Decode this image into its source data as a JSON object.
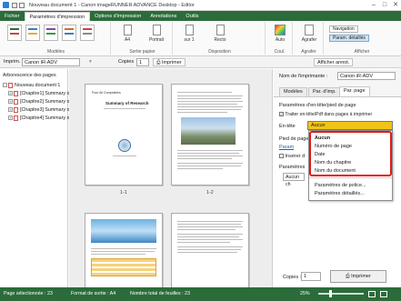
{
  "window": {
    "title": "Nouveau document 1 - Canon imageRUNNER ADVANCE Desktop - Editor",
    "controls": [
      "–",
      "□",
      "✕"
    ]
  },
  "ribbon_tabs": [
    "Fichier",
    "Paramètres d'impression",
    "Options d'impression",
    "Annotations",
    "Outils"
  ],
  "ribbon": {
    "groups": {
      "models": "Modèles",
      "sortie": "Sortie papier",
      "disposition": "Disposition",
      "couleur": "Coul.",
      "agrafer": "Agrafer",
      "afficher": "Afficher"
    },
    "buttons": {
      "a4": "A4",
      "portrait": "Portrait",
      "sur1": "sur 1",
      "recto": "Recto",
      "auto": "Auto",
      "agrafer": "Agrafer",
      "navigation": "Navigation",
      "param_details": "Param. détaillés"
    }
  },
  "toolbar": {
    "imprim_label": "Imprim.",
    "printer": "Canon iR-ADV",
    "copies_label": "Copies",
    "copies_value": "1",
    "print_button": "Imprimer",
    "show_annot": "Afficher annot."
  },
  "tree": {
    "title": "Arborescence des pages",
    "items": [
      "Nouveau document 1",
      "[Chapitre1] Summary o",
      "[Chapitre2] Summary o",
      "[Chapitre3] Summary o",
      "[Chapitre4] Summary o"
    ]
  },
  "preview": {
    "pages": [
      "1-1",
      "1-2"
    ],
    "page1_head": "Pour Ali Comptables",
    "page1_title": "Summary of Research"
  },
  "settings": {
    "printer_label": "Nom de l'imprimante :",
    "printer_value": "Canon iR-ADV",
    "tabs": [
      "Modèles",
      "Par. d'imp.",
      "Par. page"
    ],
    "section_header": "Paramètres d'en-tête/pied de page",
    "checkbox_label": "Traiter en-tête/Pdf dans pages à imprimer",
    "entete_label": "En-tête",
    "entete_value": "Aucun",
    "pied_label": "Pied de page",
    "param_label": "Param",
    "inserer_label": "Insérer d",
    "parametres_label": "Paramètres",
    "aucun_label": "Aucun ch",
    "copies_label": "Copies :",
    "copies_value": "1",
    "print_button": "Imprimer"
  },
  "dropdown": {
    "options": [
      "Aucun",
      "Numéro de page",
      "Date",
      "Nom du chapitre",
      "Nom du document"
    ],
    "selected": "Aucun",
    "extra": [
      "Paramètres de police...",
      "Paramètres détaillés..."
    ]
  },
  "status": {
    "pages_selected": "Page sélectionnée : 23",
    "format": "Format de sortie : A4",
    "sheets": "Nombre total de feuilles : 23",
    "zoom": "25%"
  },
  "colors": {
    "accent": "#2b6c3a",
    "highlight": "#e01a1a",
    "selection": "#f0c419"
  }
}
